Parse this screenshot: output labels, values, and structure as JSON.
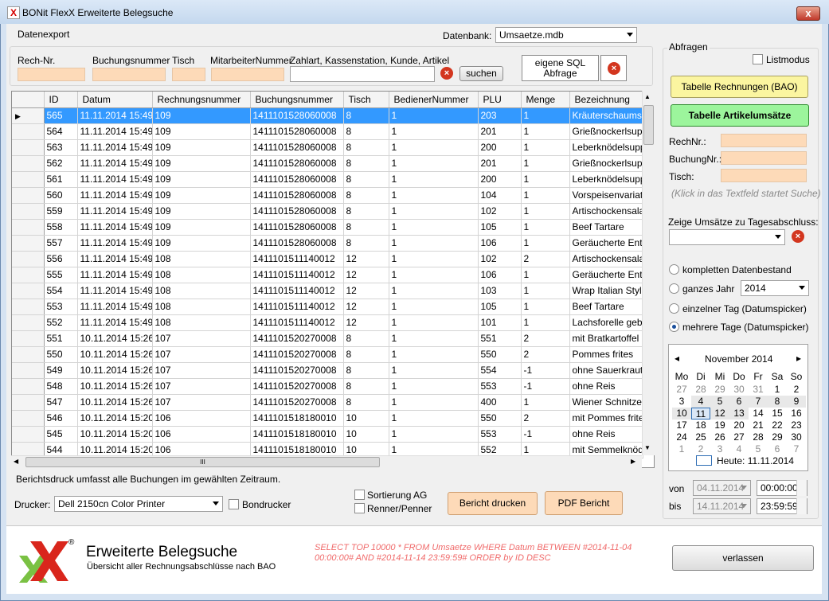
{
  "window": {
    "title": "BONit FlexX Erweiterte Belegsuche",
    "icon_letter": "X",
    "close_label": "x"
  },
  "menu": {
    "datenexport": "Datenexport"
  },
  "datenbank": {
    "label": "Datenbank:",
    "value": "Umsaetze.mdb"
  },
  "filters": {
    "rech_nr": "Rech-Nr.",
    "buchungsnummer": "Buchungsnummer",
    "tisch": "Tisch",
    "mitarbeiter": "MitarbeiterNummer",
    "zahlart": "Zahlart, Kassenstation, Kunde, Artikel",
    "suchen": "suchen",
    "eigene_sql_1": "eigene SQL",
    "eigene_sql_2": "Abfrage"
  },
  "grid": {
    "columns": [
      "ID",
      "Datum",
      "Rechnungsnummer",
      "Buchungsnummer",
      "Tisch",
      "BedienerNummer",
      "PLU",
      "Menge",
      "Bezeichnung"
    ],
    "rows": [
      [
        "565",
        "11.11.2014 15:49",
        "109",
        "1411101528060008",
        "8",
        "1",
        "203",
        "1",
        "Kräuterschaumsu"
      ],
      [
        "564",
        "11.11.2014 15:49",
        "109",
        "1411101528060008",
        "8",
        "1",
        "201",
        "1",
        "Grießnockerlsupp"
      ],
      [
        "563",
        "11.11.2014 15:49",
        "109",
        "1411101528060008",
        "8",
        "1",
        "200",
        "1",
        "Leberknödelsupp"
      ],
      [
        "562",
        "11.11.2014 15:49",
        "109",
        "1411101528060008",
        "8",
        "1",
        "201",
        "1",
        "Grießnockerlsupp"
      ],
      [
        "561",
        "11.11.2014 15:49",
        "109",
        "1411101528060008",
        "8",
        "1",
        "200",
        "1",
        "Leberknödelsupp"
      ],
      [
        "560",
        "11.11.2014 15:49",
        "109",
        "1411101528060008",
        "8",
        "1",
        "104",
        "1",
        "Vorspeisenvariatio"
      ],
      [
        "559",
        "11.11.2014 15:49",
        "109",
        "1411101528060008",
        "8",
        "1",
        "102",
        "1",
        "Artischockensalat"
      ],
      [
        "558",
        "11.11.2014 15:49",
        "109",
        "1411101528060008",
        "8",
        "1",
        "105",
        "1",
        "Beef Tartare"
      ],
      [
        "557",
        "11.11.2014 15:49",
        "109",
        "1411101528060008",
        "8",
        "1",
        "106",
        "1",
        "Geräucherte Ente"
      ],
      [
        "556",
        "11.11.2014 15:49",
        "108",
        "1411101511140012",
        "12",
        "1",
        "102",
        "2",
        "Artischockensalat"
      ],
      [
        "555",
        "11.11.2014 15:49",
        "108",
        "1411101511140012",
        "12",
        "1",
        "106",
        "1",
        "Geräucherte Ente"
      ],
      [
        "554",
        "11.11.2014 15:49",
        "108",
        "1411101511140012",
        "12",
        "1",
        "103",
        "1",
        "Wrap Italian Style"
      ],
      [
        "553",
        "11.11.2014 15:49",
        "108",
        "1411101511140012",
        "12",
        "1",
        "105",
        "1",
        "Beef Tartare"
      ],
      [
        "552",
        "11.11.2014 15:49",
        "108",
        "1411101511140012",
        "12",
        "1",
        "101",
        "1",
        "Lachsforelle gebe"
      ],
      [
        "551",
        "10.11.2014 15:26",
        "107",
        "1411101520270008",
        "8",
        "1",
        "551",
        "2",
        "mit Bratkartoffel"
      ],
      [
        "550",
        "10.11.2014 15:26",
        "107",
        "1411101520270008",
        "8",
        "1",
        "550",
        "2",
        "Pommes frites"
      ],
      [
        "549",
        "10.11.2014 15:26",
        "107",
        "1411101520270008",
        "8",
        "1",
        "554",
        "-1",
        "ohne Sauerkraut"
      ],
      [
        "548",
        "10.11.2014 15:26",
        "107",
        "1411101520270008",
        "8",
        "1",
        "553",
        "-1",
        "ohne Reis"
      ],
      [
        "547",
        "10.11.2014 15:26",
        "107",
        "1411101520270008",
        "8",
        "1",
        "400",
        "1",
        "Wiener Schnitzel"
      ],
      [
        "546",
        "10.11.2014 15:20",
        "106",
        "1411101518180010",
        "10",
        "1",
        "550",
        "2",
        "mit Pommes frites"
      ],
      [
        "545",
        "10.11.2014 15:20",
        "106",
        "1411101518180010",
        "10",
        "1",
        "553",
        "-1",
        "ohne Reis"
      ],
      [
        "544",
        "10.11.2014 15:20",
        "106",
        "1411101518180010",
        "10",
        "1",
        "552",
        "1",
        "mit Semmelknöde"
      ]
    ],
    "hscroll_thumb": "III"
  },
  "bottom": {
    "hint": "Berichtsdruck umfasst alle Buchungen im gewählten Zeitraum.",
    "drucker_label": "Drucker:",
    "drucker_value": "Dell 2150cn Color Printer",
    "bondrucker": "Bondrucker",
    "sortierung": "Sortierung AG",
    "renner": "Renner/Penner",
    "bericht_drucken": "Bericht drucken",
    "pdf_bericht": "PDF Bericht"
  },
  "side": {
    "abfragen": "Abfragen",
    "listmodus": "Listmodus",
    "tabelle_rechnungen": "Tabelle Rechnungen (BAO)",
    "tabelle_artikel": "Tabelle Artikelumsätze",
    "rechnr": "RechNr.:",
    "buchungnr": "BuchungNr.:",
    "tisch": "Tisch:",
    "klick_hint": "(Klick in das Textfeld startet Suche)",
    "zeige_umsaetze": "Zeige Umsätze zu Tagesabschluss:",
    "opt_komplett": "kompletten Datenbestand",
    "opt_jahr": "ganzes Jahr",
    "jahr_value": "2014",
    "opt_tag": "einzelner Tag (Datumspicker)",
    "opt_tage": "mehrere Tage (Datumspicker)",
    "von_label": "von",
    "bis_label": "bis",
    "von_date": "04.11.2014",
    "bis_date": "14.11.2014",
    "von_time": "00:00:00",
    "bis_time": "23:59:59"
  },
  "calendar": {
    "month": "November 2014",
    "prev": "◂",
    "next": "▸",
    "weekdays": [
      "Mo",
      "Di",
      "Mi",
      "Do",
      "Fr",
      "Sa",
      "So"
    ],
    "days": [
      "27",
      "28",
      "29",
      "30",
      "31",
      "1",
      "2",
      "3",
      "4",
      "5",
      "6",
      "7",
      "8",
      "9",
      "10",
      "11",
      "12",
      "13",
      "14",
      "15",
      "16",
      "17",
      "18",
      "19",
      "20",
      "21",
      "22",
      "23",
      "24",
      "25",
      "26",
      "27",
      "28",
      "29",
      "30",
      "1",
      "2",
      "3",
      "4",
      "5",
      "6",
      "7"
    ],
    "today_label": "Heute: 11.11.2014"
  },
  "footer": {
    "title": "Erweiterte Belegsuche",
    "subtitle": "Übersicht aller Rechnungsabschlüsse nach BAO",
    "registered": "®",
    "sql": "SELECT TOP 10000 * FROM Umsaetze WHERE Datum BETWEEN #2014-11-04 00:00:00# AND #2014-11-14 23:59:59# ORDER by ID DESC",
    "verlassen": "verlassen"
  },
  "colors": {
    "peach": "#fddab8",
    "yellow_button": "#fbf5a0",
    "green_button": "#9cf59c",
    "selection": "#3399ff",
    "logo_red": "#d9261c",
    "logo_green": "#7ac143"
  }
}
